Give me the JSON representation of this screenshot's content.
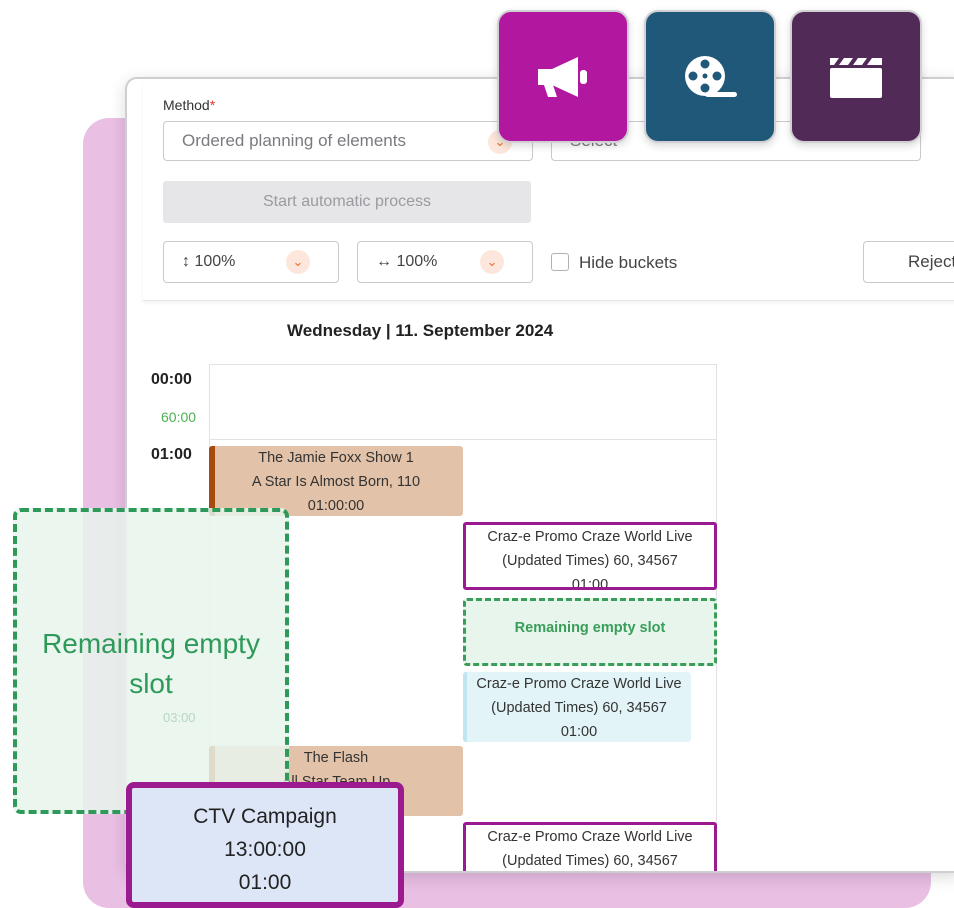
{
  "controls": {
    "method_label": "Method",
    "required_mark": "*",
    "method_value": "Ordered planning of elements",
    "second_select_placeholder": "Select",
    "start_button": "Start automatic process",
    "zoom_vertical": "100%",
    "zoom_horizontal": "100%",
    "hide_buckets_label": "Hide buckets",
    "reject_button": "Reject"
  },
  "schedule": {
    "day_header": "Wednesday | 11. September 2024",
    "times": [
      "00:00",
      "01:00"
    ],
    "durations": [
      "60:00"
    ],
    "faded_time": "03:00",
    "events": [
      {
        "title": "The Jamie Foxx Show 1",
        "subtitle": "A Star Is Almost Born, 110",
        "duration": "01:00:00"
      },
      {
        "title": "Craz-e Promo Craze World Live",
        "subtitle": "(Updated Times) 60, 34567",
        "duration": "01:00"
      },
      {
        "title": "Remaining empty slot"
      },
      {
        "title": "Craz-e Promo Craze World Live",
        "subtitle": "(Updated Times) 60, 34567",
        "duration": "01:00"
      },
      {
        "title": "The Flash",
        "subtitle": "All Star Team Up"
      },
      {
        "title": "Craz-e Promo Craze World Live",
        "subtitle": "(Updated Times) 60, 34567"
      }
    ]
  },
  "overlay": {
    "empty_slot_label": "Remaining empty slot",
    "ctv_title": "CTV Campaign",
    "ctv_time": "13:00:00",
    "ctv_duration": "01:00"
  },
  "icons": {
    "megaphone_color": "#b2189f",
    "film_reel_color": "#1f5878",
    "clapperboard_color": "#522a57"
  }
}
